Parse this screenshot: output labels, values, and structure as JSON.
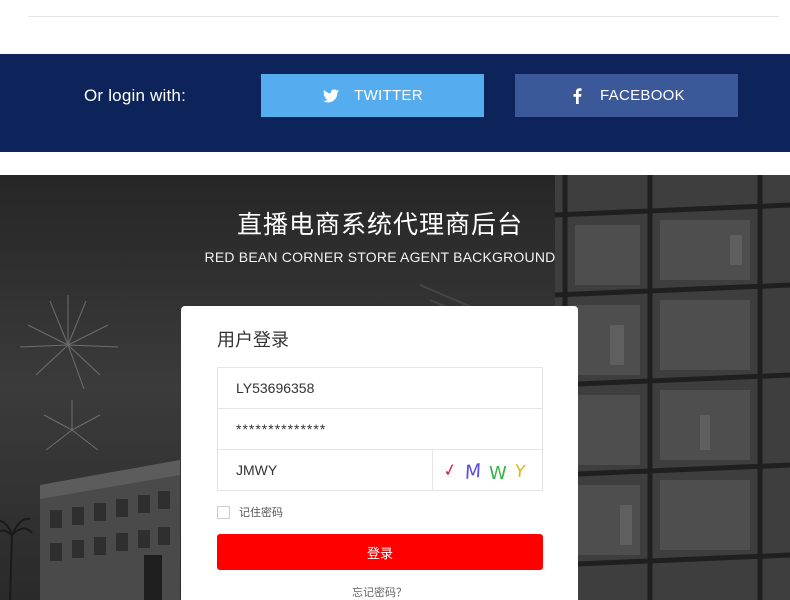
{
  "social": {
    "prompt": "Or login with:",
    "twitter_label": "TWITTER",
    "facebook_label": "FACEBOOK",
    "twitter_icon": "twitter-bird-icon",
    "facebook_icon": "facebook-f-icon",
    "colors": {
      "band": "#0c2459",
      "twitter": "#55acee",
      "facebook": "#3b5998"
    }
  },
  "hero": {
    "title": "直播电商系统代理商后台",
    "subtitle": "RED BEAN CORNER STORE AGENT BACKGROUND"
  },
  "login": {
    "heading": "用户登录",
    "username_value": "LY53696358",
    "password_value": "**************",
    "captcha_input_value": "JMWY",
    "captcha_chars": [
      "✓",
      "M",
      "W",
      "Y"
    ],
    "remember_label": "记住密码",
    "remember_checked": false,
    "submit_label": "登录",
    "forgot_label": "忘记密码？",
    "colors": {
      "submit": "#ff0000"
    }
  }
}
